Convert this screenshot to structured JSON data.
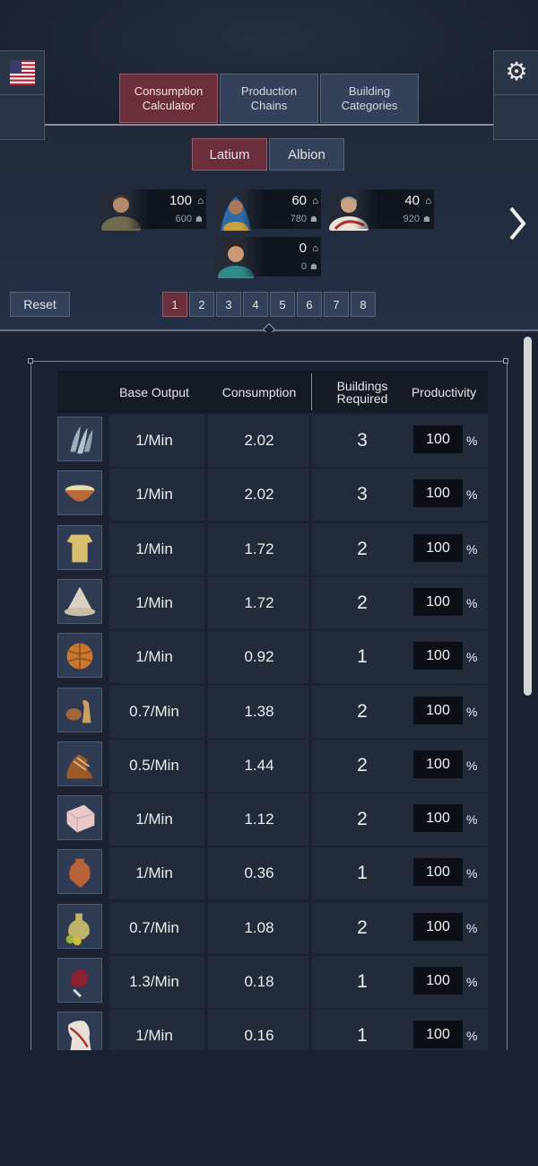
{
  "language_flag": "us-flag-icon",
  "settings_icon": "gear-icon",
  "tabs": [
    {
      "label": "Consumption\nCalculator",
      "active": true
    },
    {
      "label": "Production\nChains",
      "active": false
    },
    {
      "label": "Building\nCategories",
      "active": false
    }
  ],
  "regions": [
    {
      "label": "Latium",
      "active": true
    },
    {
      "label": "Albion",
      "active": false
    }
  ],
  "populations": [
    {
      "value": "100",
      "sub": "600"
    },
    {
      "value": "60",
      "sub": "780"
    },
    {
      "value": "40",
      "sub": "920"
    },
    {
      "value": "0",
      "sub": "0"
    }
  ],
  "reset_label": "Reset",
  "pages": [
    "1",
    "2",
    "3",
    "4",
    "5",
    "6",
    "7",
    "8"
  ],
  "active_page": "1",
  "table": {
    "headers": {
      "base_output": "Base Output",
      "consumption": "Consumption",
      "buildings_required": "Buildings\nRequired",
      "productivity": "Productivity"
    },
    "rows": [
      {
        "icon": "fish-icon",
        "base": "1/Min",
        "consumption": "2.02",
        "buildings": "3",
        "productivity": "100"
      },
      {
        "icon": "porridge-bowl-icon",
        "base": "1/Min",
        "consumption": "2.02",
        "buildings": "3",
        "productivity": "100"
      },
      {
        "icon": "tunic-icon",
        "base": "1/Min",
        "consumption": "1.72",
        "buildings": "2",
        "productivity": "100"
      },
      {
        "icon": "hat-icon",
        "base": "1/Min",
        "consumption": "1.72",
        "buildings": "2",
        "productivity": "100"
      },
      {
        "icon": "bread-icon",
        "base": "1/Min",
        "consumption": "0.92",
        "buildings": "1",
        "productivity": "100"
      },
      {
        "icon": "pottery-icon",
        "base": "0.7/Min",
        "consumption": "1.38",
        "buildings": "2",
        "productivity": "100"
      },
      {
        "icon": "sandal-icon",
        "base": "0.5/Min",
        "consumption": "1.44",
        "buildings": "2",
        "productivity": "100"
      },
      {
        "icon": "soap-icon",
        "base": "1/Min",
        "consumption": "1.12",
        "buildings": "2",
        "productivity": "100"
      },
      {
        "icon": "amphora-icon",
        "base": "1/Min",
        "consumption": "0.36",
        "buildings": "1",
        "productivity": "100"
      },
      {
        "icon": "olive-oil-icon",
        "base": "0.7/Min",
        "consumption": "1.08",
        "buildings": "2",
        "productivity": "100"
      },
      {
        "icon": "wine-icon",
        "base": "1.3/Min",
        "consumption": "0.18",
        "buildings": "1",
        "productivity": "100"
      },
      {
        "icon": "toga-icon",
        "base": "1/Min",
        "consumption": "0.16",
        "buildings": "1",
        "productivity": "100"
      }
    ],
    "percent_sign": "%"
  },
  "colors": {
    "accent": "#6b2e3c",
    "button": "#33425a",
    "background": "#1b2130"
  }
}
